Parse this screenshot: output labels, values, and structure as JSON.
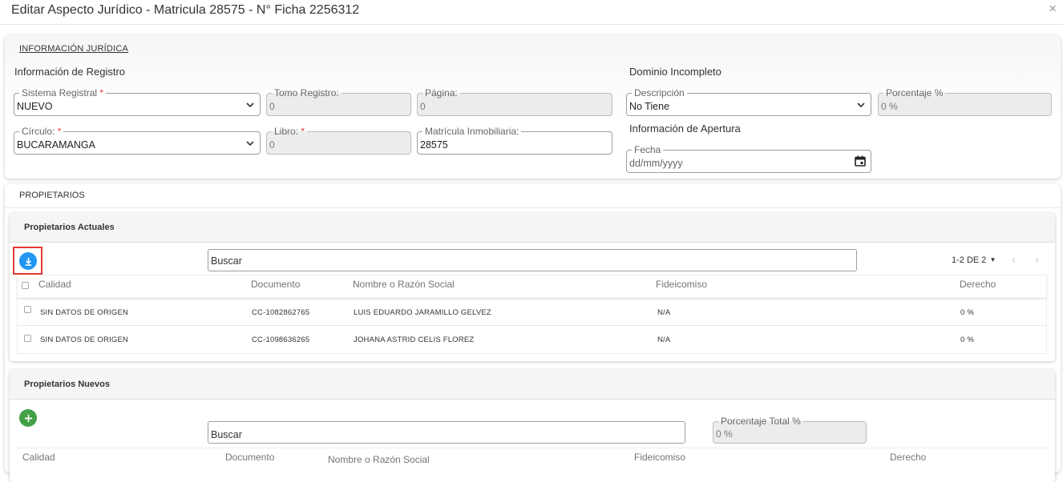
{
  "dialog": {
    "title": "Editar Aspecto Jurídico - Matricula 28575 - N° Ficha 2256312",
    "close": "×"
  },
  "juridica": {
    "section_title": "INFORMACIÓN JURÍDICA",
    "registro_title": "Información de Registro",
    "sistema_registral": {
      "label": "Sistema Registral",
      "required": "*",
      "value": "NUEVO"
    },
    "tomo_registro": {
      "label": "Tomo Registro:",
      "value": "0"
    },
    "pagina": {
      "label": "Página:",
      "value": "0"
    },
    "circulo": {
      "label": "Círculo:",
      "required": "*",
      "value": "BUCARAMANGA"
    },
    "libro": {
      "label": "Libro:",
      "required": "*",
      "value": "0"
    },
    "matricula_inmobiliaria": {
      "label": "Matrícula Inmobiliaria:",
      "value": "28575"
    },
    "dominio_title": "Dominio Incompleto",
    "descripcion": {
      "label": "Descripción",
      "value": "No Tiene"
    },
    "porcentaje": {
      "label": "Porcentaje %",
      "value": "0 %"
    },
    "apertura_title": "Información de Apertura",
    "fecha": {
      "label": "Fecha",
      "placeholder": "dd/mm/yyyy"
    }
  },
  "propietarios": {
    "section_title": "PROPIETARIOS",
    "actuales": {
      "title": "Propietarios Actuales",
      "search_placeholder": "Buscar",
      "pagination": "1-2 DE 2",
      "columns": [
        "Calidad",
        "Documento",
        "Nombre o Razón Social",
        "Fideicomiso",
        "Derecho"
      ],
      "rows": [
        {
          "calidad": "SIN DATOS DE ORIGEN",
          "documento": "CC-1082862765",
          "nombre": "LUIS EDUARDO JARAMILLO GELVEZ",
          "fideicomiso": "N/A",
          "derecho": "0 %"
        },
        {
          "calidad": "SIN DATOS DE ORIGEN",
          "documento": "CC-1098636265",
          "nombre": "JOHANA ASTRID CELIS FLOREZ",
          "fideicomiso": "N/A",
          "derecho": "0 %"
        }
      ]
    },
    "nuevos": {
      "title": "Propietarios Nuevos",
      "search_placeholder": "Buscar",
      "porcentaje_total": {
        "label": "Porcentaje Total %",
        "value": "0 %"
      },
      "columns": [
        "Calidad",
        "Documento",
        "Nombre o Razón Social",
        "Fideicomiso",
        "Derecho"
      ]
    }
  },
  "colors": {
    "download_btn": "#2196f3",
    "add_btn": "#43a047",
    "highlight": "#e53935",
    "required": "#e53935"
  },
  "icons": {
    "download": "download-icon",
    "add": "plus-icon",
    "calendar": "calendar-icon",
    "chevron": "chevron-down-icon"
  }
}
